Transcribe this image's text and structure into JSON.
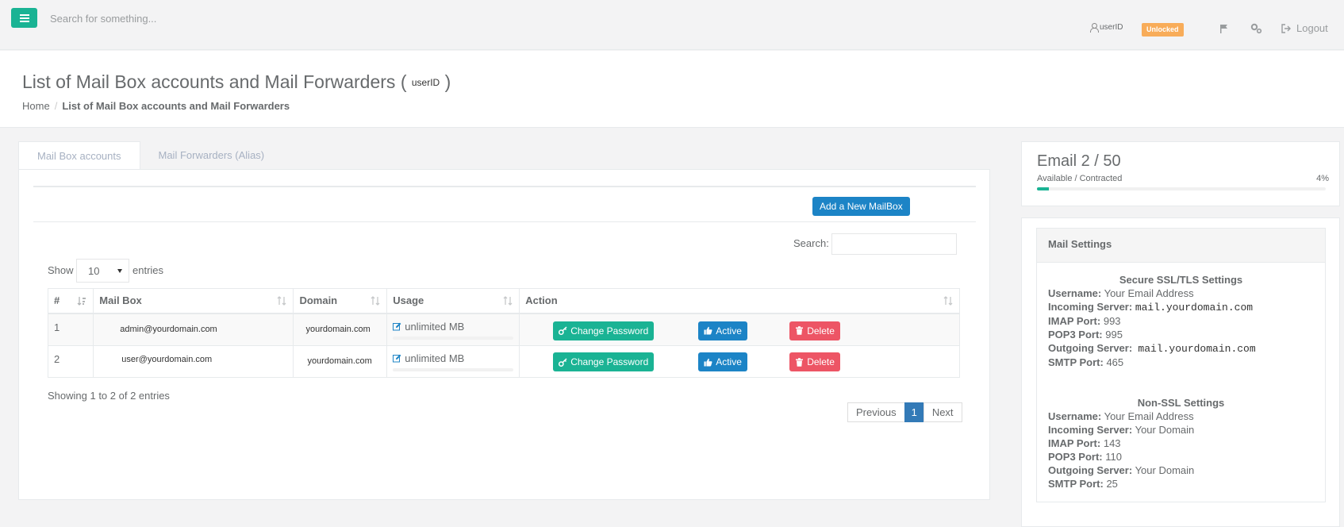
{
  "topbar": {
    "search_placeholder": "Search for something...",
    "user": "userID",
    "status_badge": "Unlocked",
    "logout_label": "Logout"
  },
  "heading": {
    "title": "List of Mail Box accounts and Mail Forwarders",
    "title_user": "userID",
    "breadcrumb": {
      "home": "Home",
      "current": "List of Mail Box accounts and Mail Forwarders"
    }
  },
  "tabs": [
    {
      "label": "Mail Box accounts",
      "active": true
    },
    {
      "label": "Mail Forwarders (Alias)",
      "active": false
    }
  ],
  "toolbar": {
    "add_label": "Add a New MailBox"
  },
  "datatable": {
    "search_label": "Search:",
    "show_label": "Show",
    "page_size": "10",
    "entries_label": "entries",
    "columns": [
      "#",
      "Mail Box",
      "Domain",
      "Usage",
      "Action"
    ],
    "rows": [
      {
        "num": "1",
        "mailbox": "admin@yourdomain.com",
        "domain": "yourdomain.com",
        "usage": "unlimited MB"
      },
      {
        "num": "2",
        "mailbox": "user@yourdomain.com",
        "domain": "yourdomain.com",
        "usage": "unlimited MB"
      }
    ],
    "actions": {
      "change_password": "Change Password",
      "active": "Active",
      "delete": "Delete"
    },
    "info": "Showing 1 to 2 of 2 entries",
    "pagination": {
      "previous": "Previous",
      "current": "1",
      "next": "Next"
    }
  },
  "email_stat": {
    "title": "Email 2 / 50",
    "subtitle": "Available / Contracted",
    "percent_label": "4%",
    "percent": 4
  },
  "mail_settings": {
    "title": "Mail Settings",
    "secure": {
      "heading": "Secure SSL/TLS Settings",
      "username_label": "Username:",
      "username": "Your Email Address",
      "incoming_label": "Incoming Server:",
      "incoming": "mail.yourdomain.com",
      "imap_label": "IMAP Port:",
      "imap": "993",
      "pop3_label": "POP3 Port:",
      "pop3": "995",
      "outgoing_label": "Outgoing Server:",
      "outgoing": "mail.yourdomain.com",
      "smtp_label": "SMTP Port:",
      "smtp": "465"
    },
    "nonssl": {
      "heading": "Non-SSL Settings",
      "username_label": "Username:",
      "username": "Your Email Address",
      "incoming_label": "Incoming Server:",
      "incoming": "Your Domain",
      "imap_label": "IMAP Port:",
      "imap": "143",
      "pop3_label": "POP3 Port:",
      "pop3": "110",
      "outgoing_label": "Outgoing Server:",
      "outgoing": "Your Domain",
      "smtp_label": "SMTP Port:",
      "smtp": "25"
    }
  },
  "colors": {
    "primary": "#1ab394",
    "info": "#1c84c6",
    "danger": "#ed5565",
    "warning": "#f8ac59"
  },
  "icons": [
    "hamburger-icon",
    "user-icon",
    "flag-icon",
    "gears-icon",
    "sign-out-icon",
    "sort-icon",
    "pencil-icon",
    "key-icon",
    "thumbs-up-icon",
    "trash-icon"
  ]
}
